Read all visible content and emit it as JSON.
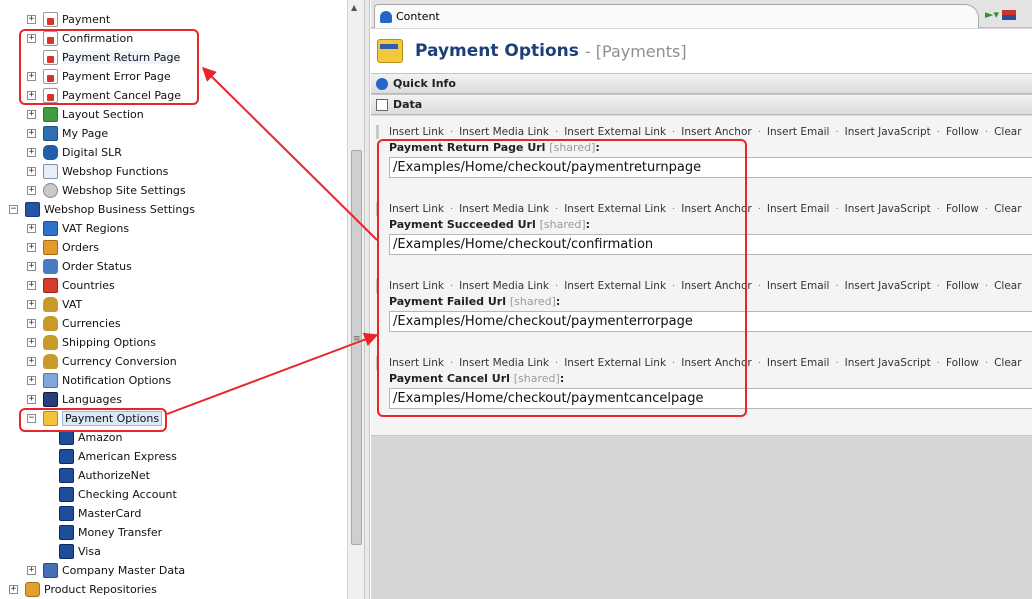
{
  "tree": {
    "nodes": [
      {
        "label": "Payment",
        "icon": "page-icon"
      },
      {
        "label": "Confirmation",
        "icon": "page-icon"
      },
      {
        "label": "Payment Return Page",
        "icon": "page-icon"
      },
      {
        "label": "Payment Error Page",
        "icon": "page-icon"
      },
      {
        "label": "Payment Cancel Page",
        "icon": "page-icon"
      },
      {
        "label": "Layout Section",
        "icon": "layout-icon"
      },
      {
        "label": "My Page",
        "icon": "grid-icon"
      },
      {
        "label": "Digital SLR",
        "icon": "camera-icon"
      },
      {
        "label": "Webshop Functions",
        "icon": "document-icon"
      },
      {
        "label": "Webshop Site Settings",
        "icon": "gear-icon"
      },
      {
        "label": "Webshop Business Settings",
        "icon": "business-icon"
      },
      {
        "label": "VAT Regions",
        "icon": "region-icon"
      },
      {
        "label": "Orders",
        "icon": "orders-icon"
      },
      {
        "label": "Order Status",
        "icon": "hourglass-icon"
      },
      {
        "label": "Countries",
        "icon": "flag-icon"
      },
      {
        "label": "VAT",
        "icon": "money-bag-icon"
      },
      {
        "label": "Currencies",
        "icon": "money-bag-icon"
      },
      {
        "label": "Shipping Options",
        "icon": "money-bag-icon"
      },
      {
        "label": "Currency Conversion",
        "icon": "money-bag-icon"
      },
      {
        "label": "Notification Options",
        "icon": "notification-icon"
      },
      {
        "label": "Languages",
        "icon": "book-icon"
      },
      {
        "label": "Payment Options",
        "icon": "payment-icon"
      },
      {
        "label": "Amazon",
        "icon": "card-icon"
      },
      {
        "label": "American Express",
        "icon": "card-icon"
      },
      {
        "label": "AuthorizeNet",
        "icon": "card-icon"
      },
      {
        "label": "Checking Account",
        "icon": "card-icon"
      },
      {
        "label": "MasterCard",
        "icon": "card-icon"
      },
      {
        "label": "Money Transfer",
        "icon": "card-icon"
      },
      {
        "label": "Visa",
        "icon": "card-icon"
      },
      {
        "label": "Company Master Data",
        "icon": "master-data-icon"
      },
      {
        "label": "Product Repositories",
        "icon": "box-icon"
      }
    ]
  },
  "tab": {
    "label": "Content"
  },
  "header": {
    "title": "Payment Options",
    "subtitle": "- [Payments]"
  },
  "sections": {
    "quick_info": "Quick Info",
    "data": "Data"
  },
  "toolbar": [
    "Insert Link",
    "Insert Media Link",
    "Insert External Link",
    "Insert Anchor",
    "Insert Email",
    "Insert JavaScript",
    "Follow",
    "Clear"
  ],
  "toolbar_separator": "·",
  "shared_tag": "[shared]",
  "fields": [
    {
      "label": "Payment Return Page Url",
      "value": "/Examples/Home/checkout/paymentreturnpage"
    },
    {
      "label": "Payment Succeeded Url",
      "value": "/Examples/Home/checkout/confirmation"
    },
    {
      "label": "Payment Failed Url",
      "value": "/Examples/Home/checkout/paymenterrorpage"
    },
    {
      "label": "Payment Cancel Url",
      "value": "/Examples/Home/checkout/paymentcancelpage"
    }
  ],
  "colors": {
    "annotation": "#e8252b",
    "title": "#1d3f7a"
  }
}
